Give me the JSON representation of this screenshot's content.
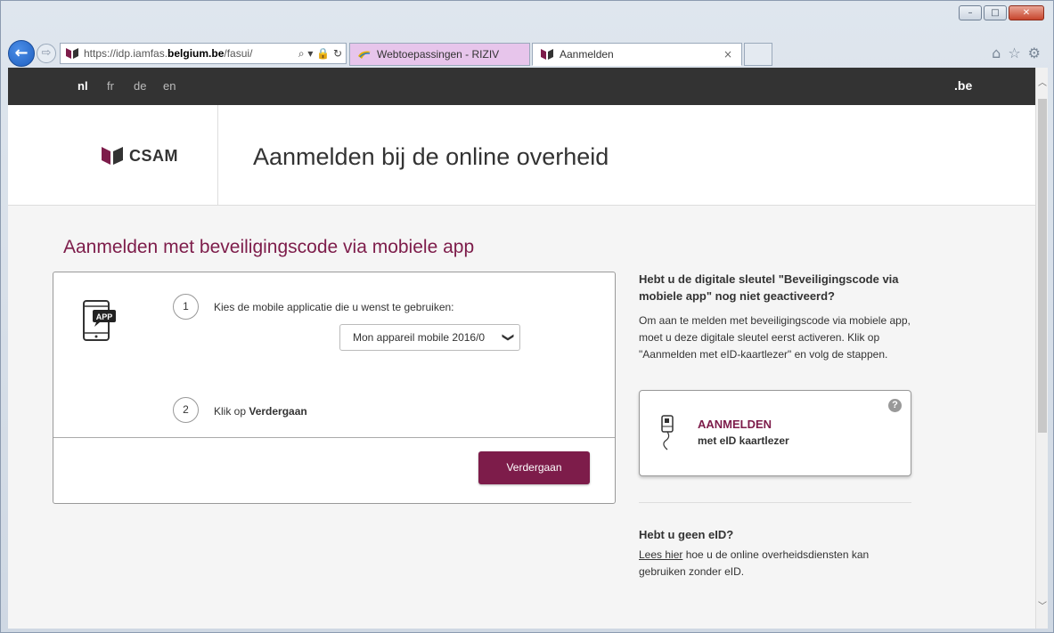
{
  "browser": {
    "url_prefix": "https://idp.iamfas.",
    "url_host": "belgium.be",
    "url_suffix": "/fasui/",
    "address_icons": "⌕ ▾ 🔒 ↻",
    "tabs": [
      {
        "label": "Webtoepassingen - RIZIV"
      },
      {
        "label": "Aanmelden",
        "close": "×"
      }
    ],
    "window_controls": {
      "minimize": "–",
      "maximize": "□",
      "close": "✕"
    },
    "toolbar_icons": {
      "home": "⌂",
      "favorites": "☆",
      "settings": "⚙"
    },
    "back": "←",
    "forward": "⇨"
  },
  "topbar": {
    "languages": [
      "nl",
      "fr",
      "de",
      "en"
    ],
    "active_language": "nl",
    "brand": ".be"
  },
  "header": {
    "logo_text": "CSAM",
    "title": "Aanmelden bij de online overheid"
  },
  "main": {
    "section_title": "Aanmelden met beveiligingscode via mobiele app",
    "phone_badge": "APP",
    "step1": {
      "number": "1",
      "text": "Kies de mobile applicatie die u wenst te gebruiken:"
    },
    "select_value": "Mon appareil mobile 2016/0",
    "select_chevron": "❯",
    "step2": {
      "number": "2",
      "text_prefix": "Klik op ",
      "text_bold": "Verdergaan"
    },
    "continue_button": "Verdergaan"
  },
  "sidebar": {
    "heading1": "Hebt u de digitale sleutel \"Beveiligingscode via mobiele app\" nog niet geactiveerd?",
    "paragraph1": "Om aan te melden met beveiligingscode via mobiele app, moet u deze digitale sleutel eerst activeren. Klik op \"Aanmelden met eID-kaartlezer\" en volg de stappen.",
    "eid_card": {
      "title": "AANMELDEN",
      "subtitle": "met eID kaartlezer",
      "help": "?"
    },
    "heading2": "Hebt u geen eID?",
    "link_text": "Lees hier",
    "paragraph2": " hoe u de online overheidsdiensten kan gebruiken zonder eID."
  },
  "scrollbar": {
    "up": "︿",
    "down": "﹀"
  },
  "colors": {
    "accent": "#7d1c4a",
    "topbar": "#333333",
    "background": "#f5f5f5"
  }
}
